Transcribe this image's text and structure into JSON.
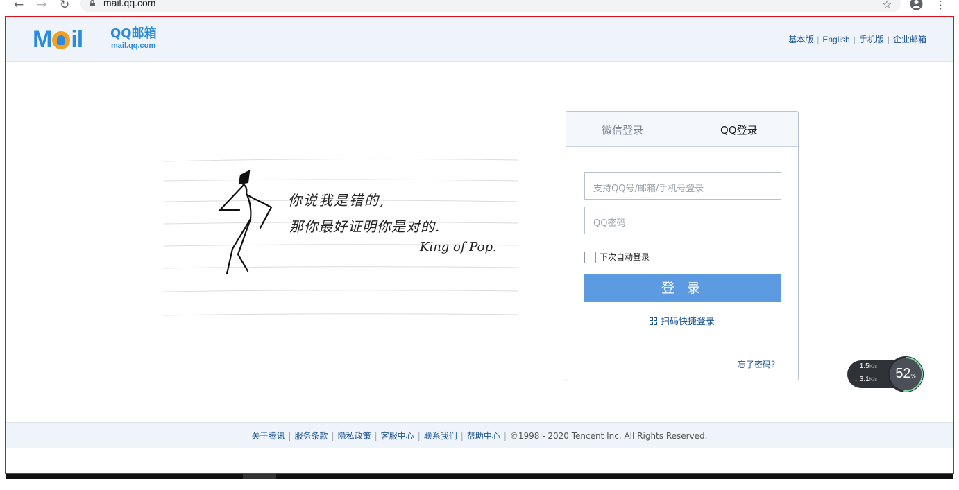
{
  "browser": {
    "back_icon": "arrow-left-icon",
    "forward_icon": "arrow-right-icon",
    "reload_icon": "reload-icon",
    "url": "mail.qq.com",
    "bookmark_icon": "star-icon",
    "account_icon": "account-icon",
    "menu_icon": "more-vert-icon"
  },
  "header": {
    "logo_mail": "Mail",
    "logo_name": "QQ邮箱",
    "logo_domain": "mail.qq.com",
    "links": [
      "基本版",
      "English",
      "手机版",
      "企业邮箱"
    ]
  },
  "illustration": {
    "line1": "你说我是错的,",
    "line2": "那你最好证明你是对的.",
    "signature": "King of Pop."
  },
  "login": {
    "tab_wechat": "微信登录",
    "tab_qq": "QQ登录",
    "user_placeholder": "支持QQ号/邮箱/手机号登录",
    "password_placeholder": "QQ密码",
    "remember_label": "下次自动登录",
    "submit_label": "登 录",
    "qr_label": "扫码快捷登录",
    "forgot_label": "忘了密码？"
  },
  "speed_widget": {
    "upload": "1.5",
    "upload_unit": "K/s",
    "download": "3.1",
    "download_unit": "K/s",
    "percent": "52",
    "percent_unit": "%"
  },
  "footer": {
    "links": [
      "关于腾讯",
      "服务条款",
      "隐私政策",
      "客服中心",
      "联系我们",
      "帮助中心"
    ],
    "copyright": "©1998 - 2020 Tencent Inc. All Rights Reserved."
  },
  "colors": {
    "accent": "#2b8be0",
    "login_button": "#5c9ae1",
    "link": "#1d5494",
    "frame_border": "#d6151b",
    "header_bg": "#eff4fa"
  }
}
